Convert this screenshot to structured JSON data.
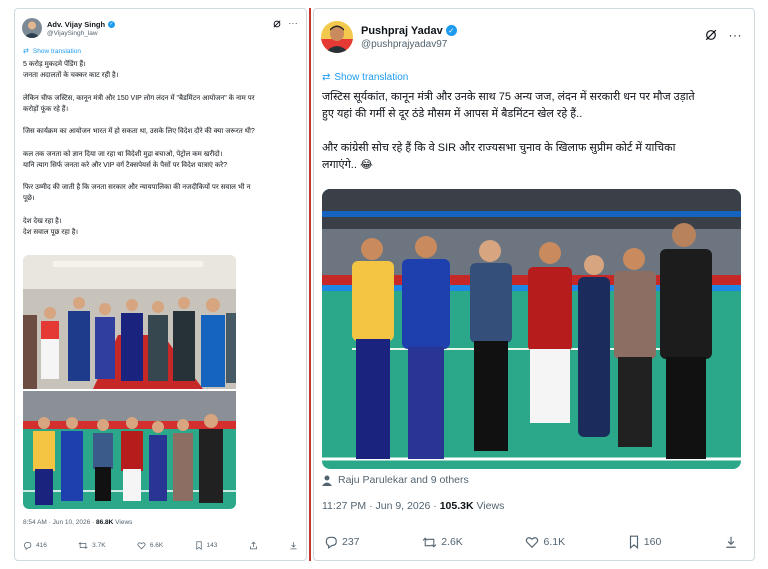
{
  "left_tweet": {
    "author_name": "Adv. Vijay Singh",
    "author_handle": "@VijaySingh_law",
    "show_translation": "Show translation",
    "lines": [
      "5 करोड़ मुकदमे पेंडिंग हैं।",
      "जनता अदालतों के चक्कर काट रही है।",
      "",
      "लेकिन चीफ जस्टिस, कानून मंत्री और 150 VIP लोग लंदन में \"बैडमिंटन आयोजन\" के नाम पर",
      "करोड़ों फूंक रहे हैं।",
      "",
      "जिस कार्यक्रम का आयोजन भारत में हो सकता था, उसके लिए विदेश दौरे की क्या जरूरत थी?",
      "",
      "कल तक जनता को ज्ञान दिया जा रहा था विदेशी मुद्रा बचाओ, पेट्रोल कम खरीदो।",
      "यानि त्याग सिर्फ जनता करे और VIP वर्ग टैक्सपेयर्स के पैसों पर विदेश यात्राएं करे?",
      "",
      "फिर उम्मीद की जाती है कि जनता सरकार और न्यायपालिका की नजदीकियों पर सवाल भी न",
      "पूछे।",
      "",
      "देश देख रहा है।",
      "देश सवाल पूछ रहा है।"
    ],
    "time": "8:54 AM · Jun 10, 2026 · ",
    "views": "86.8K",
    "views_label": " Views",
    "replies": "416",
    "retweets": "3.7K",
    "likes": "6.6K",
    "bookmarks": "143"
  },
  "right_tweet": {
    "author_name": "Pushpraj Yadav",
    "author_handle": "@pushprajyadav97",
    "show_translation": "Show translation",
    "lines": [
      "जस्टिस सूर्यकांत, कानून मंत्री और उनके साथ 75 अन्य जज, लंदन में सरकारी धन पर मौज उड़ाते",
      "हुए यहां की गर्मी से दूर ठंडे मौसम में आपस में बैडमिंटन खेल रहे हैं..",
      "",
      "और कांग्रेसी सोच रहे हैं कि वे SIR और राज्यसभा चुनाव के खिलाफ सुप्रीम कोर्ट में याचिका",
      "लगाएंगे.. 😂"
    ],
    "tagged": "Raju Parulekar and 9 others",
    "time": "11:27 PM · Jun 9, 2026 · ",
    "views": "105.3K",
    "views_label": " Views",
    "replies": "237",
    "retweets": "2.6K",
    "likes": "6.1K",
    "bookmarks": "160"
  },
  "colors": {
    "link_blue": "#1d9bf0",
    "text": "#0f1419",
    "muted": "#536471",
    "divider": "#c0392b",
    "court_green": "#2aa889"
  },
  "icons": [
    "grok-icon",
    "more-icon",
    "translate-icon",
    "verified-badge-icon",
    "reply-icon",
    "retweet-icon",
    "like-icon",
    "bookmark-icon",
    "share-icon",
    "download-icon",
    "person-tag-icon"
  ]
}
